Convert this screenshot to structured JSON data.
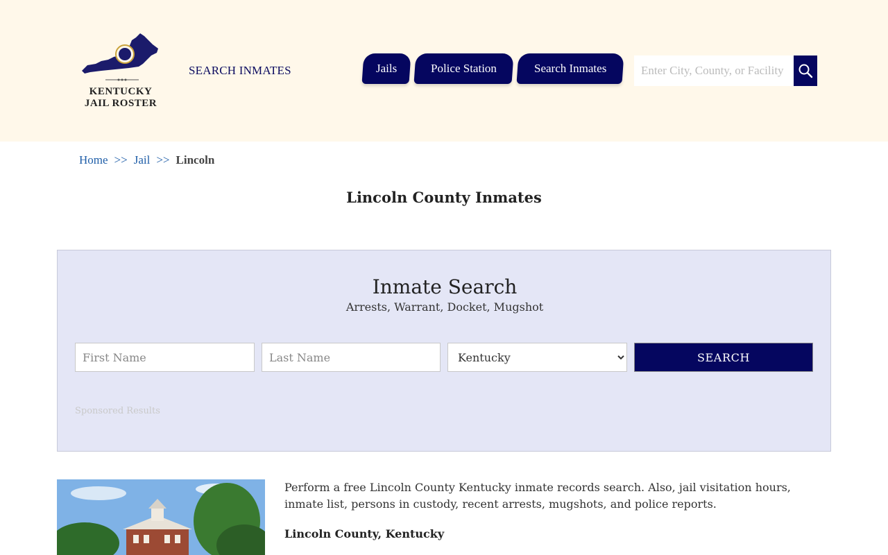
{
  "header": {
    "logo_line1": "Kentucky",
    "logo_line2": "Jail Roster",
    "search_inmates_link": "SEARCH INMATES",
    "nav": [
      {
        "label": "Jails"
      },
      {
        "label": "Police Station"
      },
      {
        "label": "Search Inmates"
      }
    ],
    "site_search_placeholder": "Enter City, County, or Facility"
  },
  "breadcrumb": {
    "home": "Home",
    "sep1": ">>",
    "jail": "Jail",
    "sep2": ">>",
    "current": "Lincoln"
  },
  "page_title": "Lincoln County Inmates",
  "search_panel": {
    "title": "Inmate Search",
    "subtitle": "Arrests, Warrant, Docket, Mugshot",
    "first_name_placeholder": "First Name",
    "last_name_placeholder": "Last Name",
    "state_selected": "Kentucky",
    "search_button": "SEARCH",
    "sponsored": "Sponsored Results"
  },
  "content": {
    "intro": "Perform a free Lincoln County Kentucky inmate records search. Also, jail visitation hours, inmate list, persons in custody, recent arrests, mugshots, and police reports.",
    "subhead": "Lincoln County, Kentucky"
  },
  "colors": {
    "header_bg": "#fff8ea",
    "navy": "#05065f",
    "panel_bg": "#e4e6f6",
    "link": "#1f5ea8"
  },
  "icons": {
    "site_search": "magnifier-icon",
    "select": "chevron-down-icon"
  }
}
